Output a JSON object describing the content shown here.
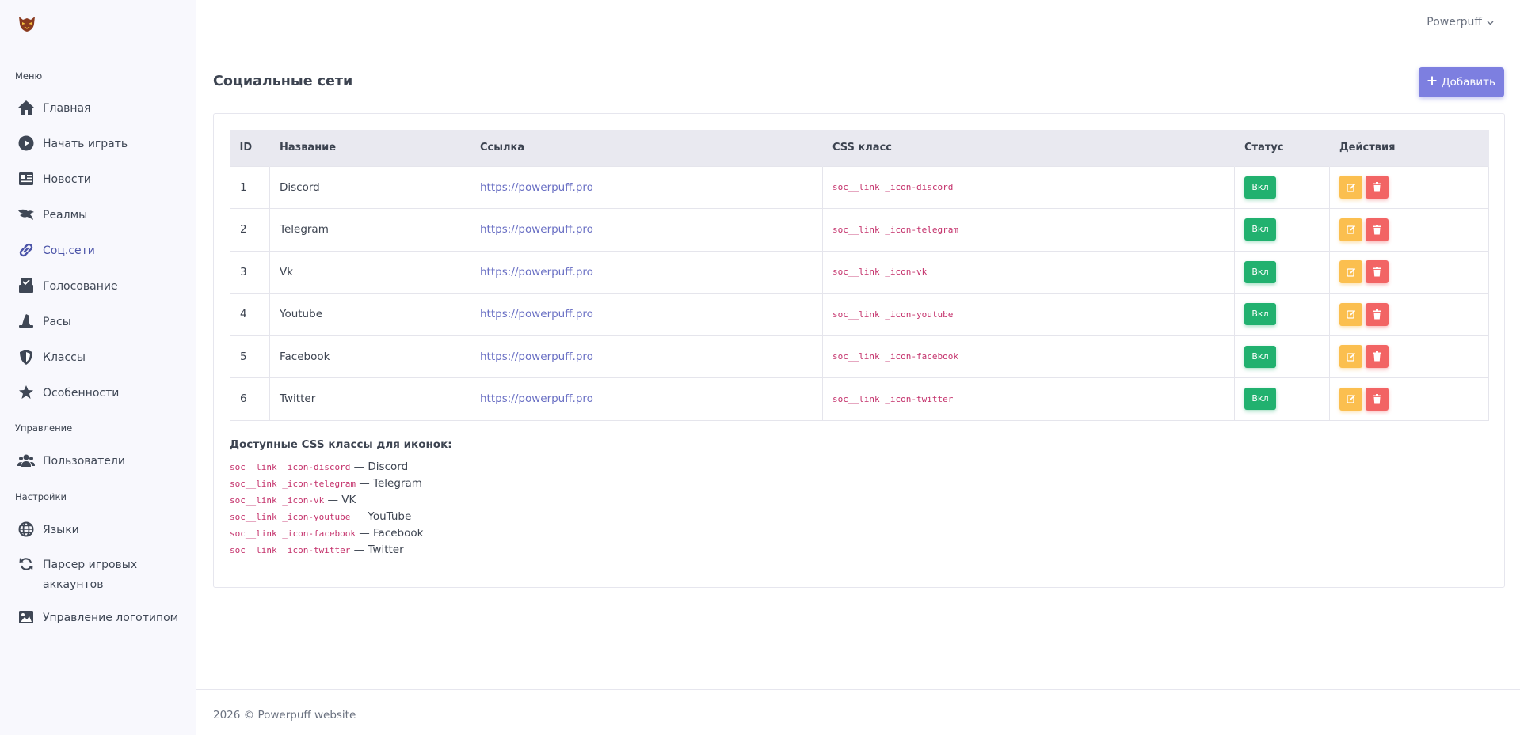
{
  "user": {
    "name": "Powerpuff"
  },
  "sidebar": {
    "sections": {
      "menu": "Меню",
      "management": "Управление",
      "settings": "Настройки"
    },
    "items": [
      {
        "label": "Главная",
        "icon": "home-icon"
      },
      {
        "label": "Начать играть",
        "icon": "play-circle-icon"
      },
      {
        "label": "Новости",
        "icon": "newspaper-icon"
      },
      {
        "label": "Реалмы",
        "icon": "dragon-icon"
      },
      {
        "label": "Соц.сети",
        "icon": "link-icon",
        "active": true
      },
      {
        "label": "Голосование",
        "icon": "vote-box-icon"
      },
      {
        "label": "Расы",
        "icon": "wizard-hat-icon"
      },
      {
        "label": "Классы",
        "icon": "shield-icon"
      },
      {
        "label": "Особенности",
        "icon": "star-icon"
      },
      {
        "label": "Пользователи",
        "icon": "users-icon"
      },
      {
        "label": "Языки",
        "icon": "globe-icon"
      },
      {
        "label": "Парсер игровых аккаунтов",
        "icon": "sync-icon"
      },
      {
        "label": "Управление логотипом",
        "icon": "image-icon"
      }
    ]
  },
  "page": {
    "title": "Социальные сети",
    "add_label": "Добавить"
  },
  "table": {
    "headers": [
      "ID",
      "Название",
      "Ссылка",
      "CSS класс",
      "Статус",
      "Действия"
    ],
    "rows": [
      {
        "id": "1",
        "name": "Discord",
        "link": "https://powerpuff.pro",
        "css": "soc__link _icon-discord",
        "status": "Вкл"
      },
      {
        "id": "2",
        "name": "Telegram",
        "link": "https://powerpuff.pro",
        "css": "soc__link _icon-telegram",
        "status": "Вкл"
      },
      {
        "id": "3",
        "name": "Vk",
        "link": "https://powerpuff.pro",
        "css": "soc__link _icon-vk",
        "status": "Вкл"
      },
      {
        "id": "4",
        "name": "Youtube",
        "link": "https://powerpuff.pro",
        "css": "soc__link _icon-youtube",
        "status": "Вкл"
      },
      {
        "id": "5",
        "name": "Facebook",
        "link": "https://powerpuff.pro",
        "css": "soc__link _icon-facebook",
        "status": "Вкл"
      },
      {
        "id": "6",
        "name": "Twitter",
        "link": "https://powerpuff.pro",
        "css": "soc__link _icon-twitter",
        "status": "Вкл"
      }
    ]
  },
  "hint": {
    "title": "Доступные CSS классы для иконок:",
    "lines": [
      {
        "code": "soc__link _icon-discord",
        "text": " — Discord"
      },
      {
        "code": "soc__link _icon-telegram",
        "text": " — Telegram"
      },
      {
        "code": "soc__link _icon-vk",
        "text": " — VK"
      },
      {
        "code": "soc__link _icon-youtube",
        "text": " — YouTube"
      },
      {
        "code": "soc__link _icon-facebook",
        "text": " — Facebook"
      },
      {
        "code": "soc__link _icon-twitter",
        "text": " — Twitter"
      }
    ]
  },
  "footer": {
    "text": "2026 © Powerpuff website"
  },
  "colors": {
    "accent": "#7d7fe0",
    "status_on": "#21b16f",
    "edit": "#fbbf4f",
    "delete": "#f26464",
    "code": "#c4316b"
  }
}
